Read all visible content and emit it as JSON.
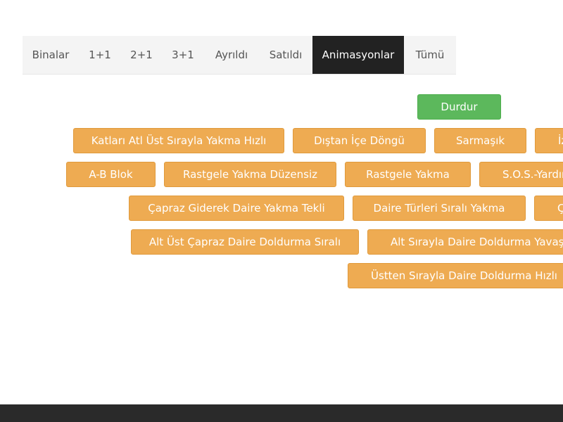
{
  "tabs": [
    {
      "label": "Binalar",
      "active": false
    },
    {
      "label": "1+1",
      "active": false
    },
    {
      "label": "2+1",
      "active": false
    },
    {
      "label": "3+1",
      "active": false
    },
    {
      "label": "Ayrıldı",
      "active": false
    },
    {
      "label": "Satıldı",
      "active": false
    },
    {
      "label": "Animasyonlar",
      "active": true
    },
    {
      "label": "Tümü",
      "active": false
    }
  ],
  "stop_button": {
    "label": "Durdur",
    "color": "#5cb85c"
  },
  "accent_color": "#eeab52",
  "animations": [
    {
      "label": "Katları Atl Üst Sırayla Yakma Hızlı"
    },
    {
      "label": "Dıştan İçe Döngü"
    },
    {
      "label": "Sarmaşık"
    },
    {
      "label": "İz"
    },
    {
      "label": "A-B Blok"
    },
    {
      "label": "Rastgele Yakma Düzensiz"
    },
    {
      "label": "Rastgele Yakma"
    },
    {
      "label": "S.O.S.-Yardım"
    },
    {
      "label": "Çapraz Giderek Daire Yakma Tekli"
    },
    {
      "label": "Daire Türleri Sıralı Yakma"
    },
    {
      "label": "Ç"
    },
    {
      "label": "Alt Üst Çapraz Daire Doldurma Sıralı"
    },
    {
      "label": "Alt Sırayla Daire Doldurma Yavaş"
    },
    {
      "label": "Üstten Sırayla Daire Doldurma Hızlı"
    }
  ]
}
